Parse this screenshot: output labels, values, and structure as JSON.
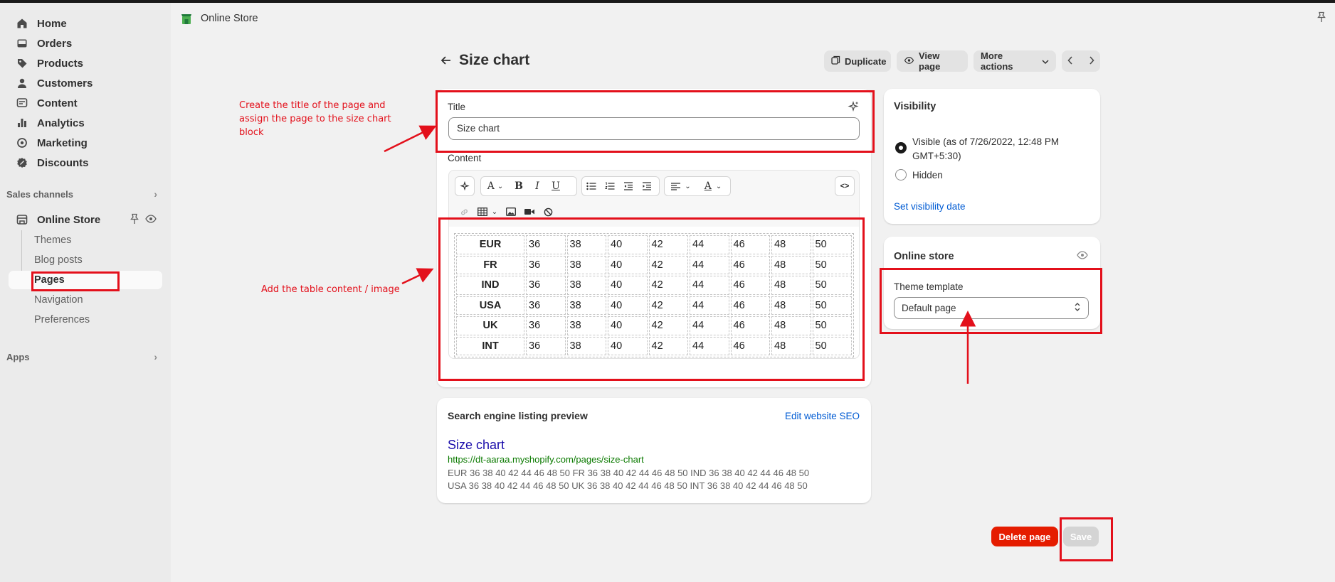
{
  "app": {
    "store_name": "Online Store"
  },
  "sidebar": {
    "items": [
      {
        "label": "Home",
        "icon": "home-icon"
      },
      {
        "label": "Orders",
        "icon": "inbox-icon"
      },
      {
        "label": "Products",
        "icon": "tag-icon"
      },
      {
        "label": "Customers",
        "icon": "person-icon"
      },
      {
        "label": "Content",
        "icon": "content-icon"
      },
      {
        "label": "Analytics",
        "icon": "bar-chart-icon"
      },
      {
        "label": "Marketing",
        "icon": "target-icon"
      },
      {
        "label": "Discounts",
        "icon": "discount-icon"
      }
    ],
    "sales_channels_label": "Sales channels",
    "online_store_label": "Online Store",
    "sub_items": [
      {
        "label": "Themes"
      },
      {
        "label": "Blog posts"
      },
      {
        "label": "Pages",
        "active": true
      },
      {
        "label": "Navigation"
      },
      {
        "label": "Preferences"
      }
    ],
    "apps_label": "Apps"
  },
  "header": {
    "title": "Size chart",
    "duplicate_label": "Duplicate",
    "view_page_label": "View page",
    "more_actions_label": "More actions"
  },
  "title_card": {
    "label": "Title",
    "value": "Size chart",
    "content_label": "Content"
  },
  "size_table": {
    "rows": [
      {
        "header": "EUR",
        "cells": [
          "36",
          "38",
          "40",
          "42",
          "44",
          "46",
          "48",
          "50"
        ]
      },
      {
        "header": "FR",
        "cells": [
          "36",
          "38",
          "40",
          "42",
          "44",
          "46",
          "48",
          "50"
        ]
      },
      {
        "header": "IND",
        "cells": [
          "36",
          "38",
          "40",
          "42",
          "44",
          "46",
          "48",
          "50"
        ]
      },
      {
        "header": "USA",
        "cells": [
          "36",
          "38",
          "40",
          "42",
          "44",
          "46",
          "48",
          "50"
        ]
      },
      {
        "header": "UK",
        "cells": [
          "36",
          "38",
          "40",
          "42",
          "44",
          "46",
          "48",
          "50"
        ]
      },
      {
        "header": "INT",
        "cells": [
          "36",
          "38",
          "40",
          "42",
          "44",
          "46",
          "48",
          "50"
        ]
      }
    ]
  },
  "seo": {
    "heading": "Search engine listing preview",
    "edit_link": "Edit website SEO",
    "preview_title": "Size chart",
    "preview_url": "https://dt-aaraa.myshopify.com/pages/size-chart",
    "preview_desc_line1": "EUR 36 38 40 42 44 46 48 50 FR 36 38 40 42 44 46 48 50 IND 36 38 40 42 44 46 48 50",
    "preview_desc_line2": "USA 36 38 40 42 44 46 48 50 UK 36 38 40 42 44 46 48 50 INT 36 38 40 42 44 46 48 50"
  },
  "visibility": {
    "heading": "Visibility",
    "visible_line1": "Visible (as of 7/26/2022, 12:48 PM",
    "visible_line2": "GMT+5:30)",
    "hidden_label": "Hidden",
    "set_date_link": "Set visibility date",
    "selected": "visible"
  },
  "online_store_card": {
    "heading": "Online store",
    "template_label": "Theme template",
    "template_value": "Default page"
  },
  "actions": {
    "delete_label": "Delete page",
    "save_label": "Save"
  },
  "annotations": {
    "title_note_line1": "Create the title of the page and",
    "title_note_line2": "assign the page to the size chart",
    "title_note_line3": "block",
    "table_note": "Add the table content / image"
  },
  "colors": {
    "annotation_red": "#e3101b",
    "link_blue": "#005bd3",
    "seo_green": "#0b7a00",
    "delete_red": "#e51c00"
  }
}
